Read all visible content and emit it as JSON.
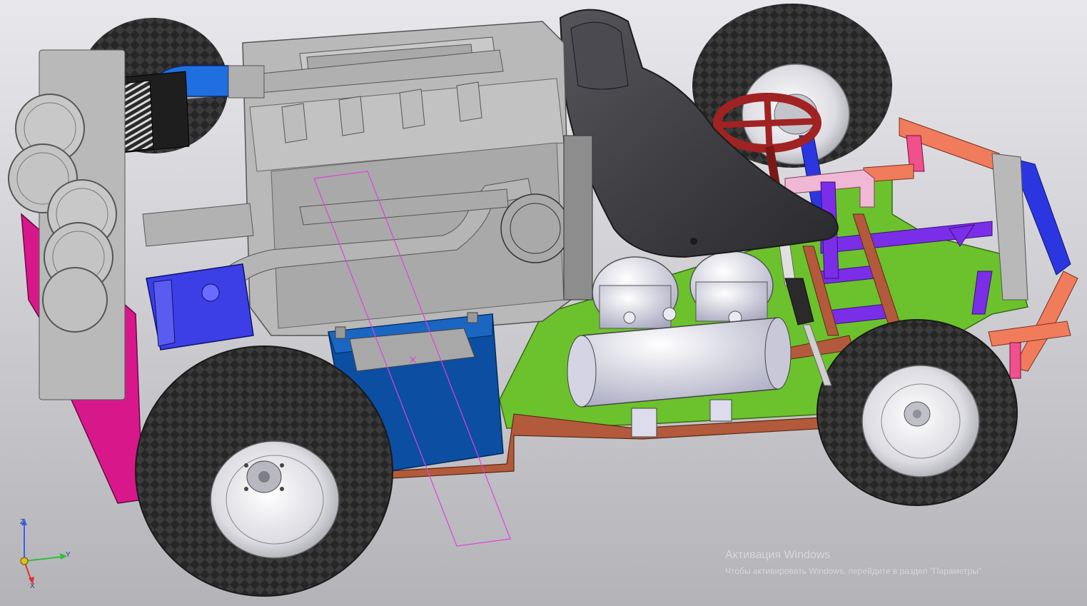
{
  "viewport": {
    "background_top": "#e8e8ec",
    "background_bottom": "#b4b4b8"
  },
  "model": {
    "colors": {
      "tire": "#3c3c3c",
      "tire_tread": "#262626",
      "rim": "#e6e6ea",
      "engine": "#b9b9b9",
      "engine_dark": "#9a9a9a",
      "intake_pipe_blue": "#1f6fe0",
      "pump_blue": "#3c3ee6",
      "battery": "#0b4ea2",
      "battery_lid": "#a8a8a8",
      "seat": "#3b3b3f",
      "steering_wheel": "#a02222",
      "floor_plate": "#6cc22c",
      "frame_tube_salmon": "#f07c5c",
      "frame_tube_pink": "#f0508c",
      "frame_tube_brown": "#b35a3c",
      "frame_tube_purple": "#7a2ee8",
      "frame_tube_blue": "#2b35e0",
      "frame_tube_lightpink": "#f0b8d4",
      "magenta_body": "#d8188a",
      "air_tank": "#dcdcec",
      "sketch_line": "#e040e0"
    }
  },
  "axis_triad": {
    "x_label": "X",
    "y_label": "Y",
    "z_label": "Z",
    "z_color": "#3a5ef0",
    "y_color": "#2fbf3f",
    "x_color": "#e03030"
  },
  "watermark": {
    "title": "Активация Windows",
    "subtitle": "Чтобы активировать Windows, перейдите в раздел \"Параметры\""
  }
}
